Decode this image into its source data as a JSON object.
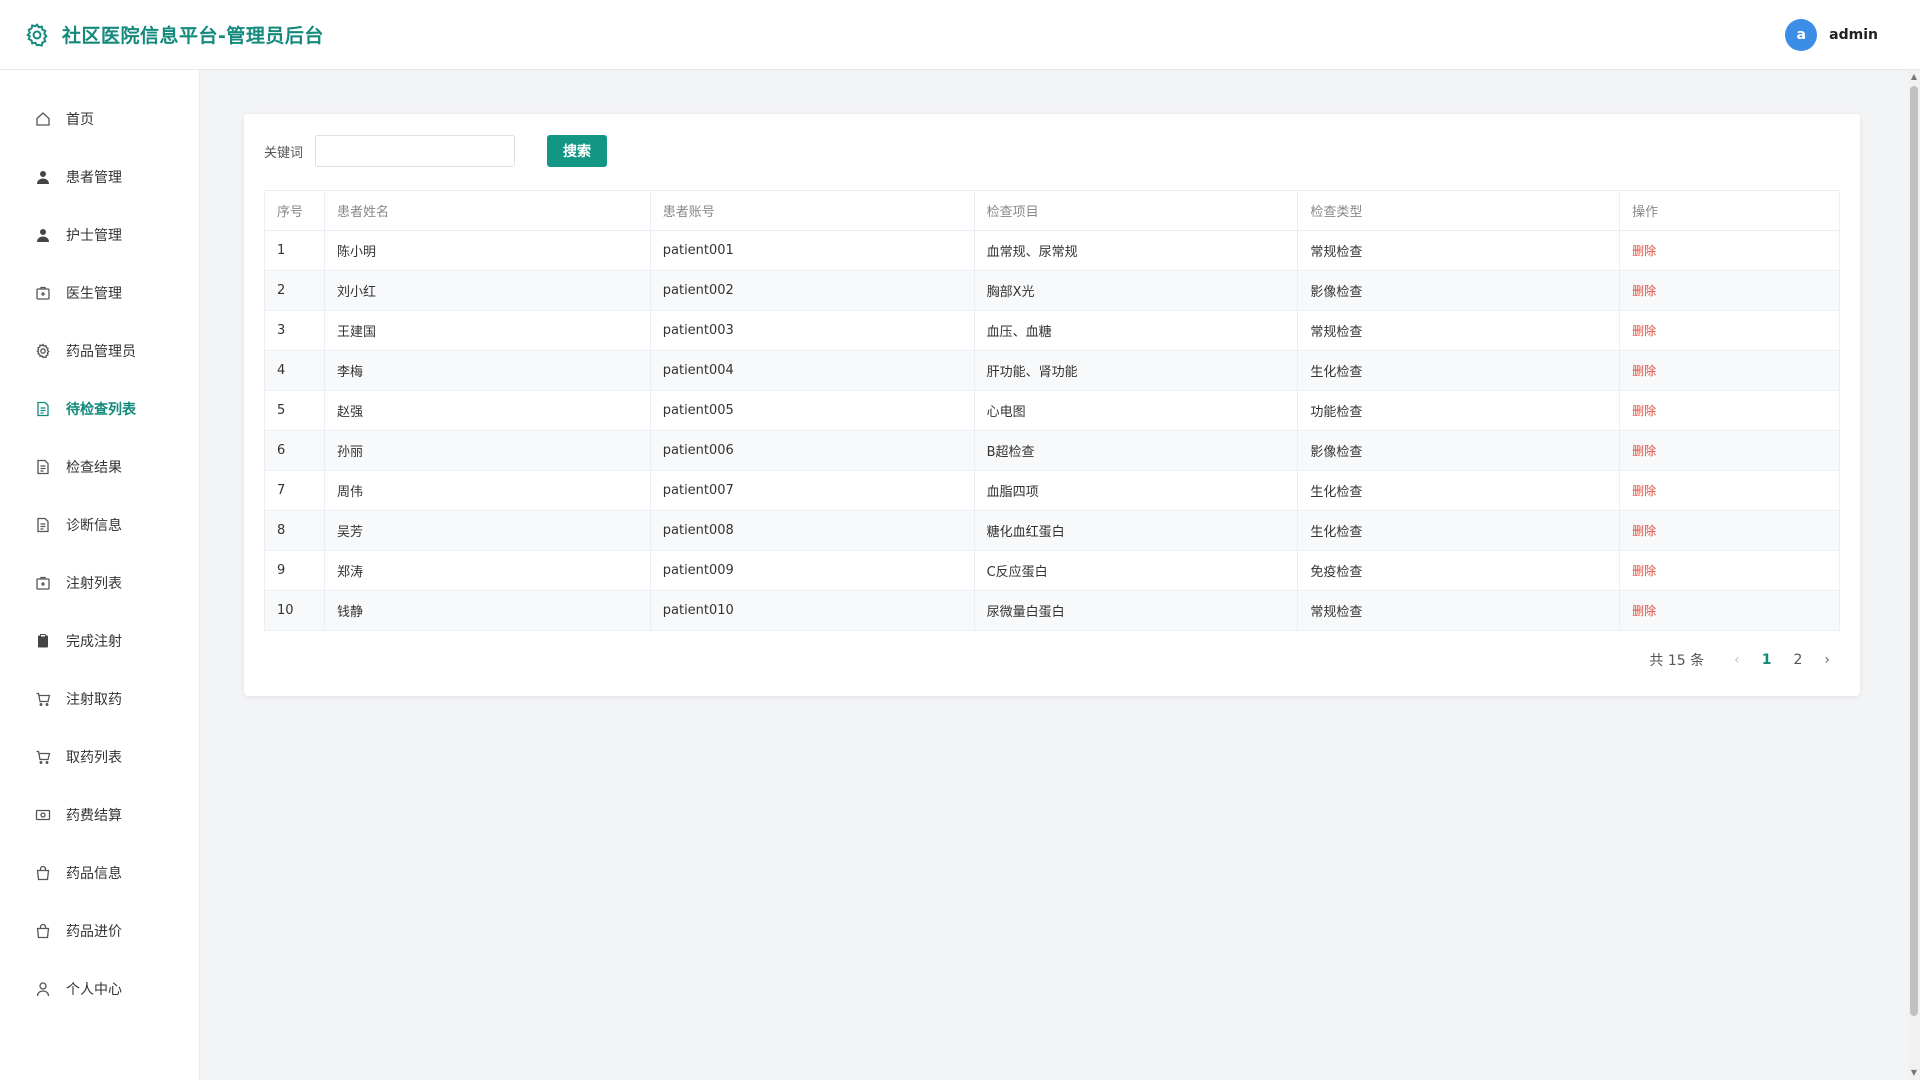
{
  "header": {
    "title": "社区医院信息平台-管理员后台",
    "avatar_letter": "a",
    "username": "admin"
  },
  "sidebar": {
    "items": [
      {
        "label": "首页",
        "icon": "home-icon"
      },
      {
        "label": "患者管理",
        "icon": "user-icon"
      },
      {
        "label": "护士管理",
        "icon": "user-icon"
      },
      {
        "label": "医生管理",
        "icon": "medkit-icon"
      },
      {
        "label": "药品管理员",
        "icon": "gear-icon"
      },
      {
        "label": "待检查列表",
        "icon": "document-icon",
        "active": true
      },
      {
        "label": "检查结果",
        "icon": "document-icon"
      },
      {
        "label": "诊断信息",
        "icon": "document-icon"
      },
      {
        "label": "注射列表",
        "icon": "medkit-icon"
      },
      {
        "label": "完成注射",
        "icon": "clipboard-icon"
      },
      {
        "label": "注射取药",
        "icon": "cart-icon"
      },
      {
        "label": "取药列表",
        "icon": "cart-icon"
      },
      {
        "label": "药费结算",
        "icon": "money-icon"
      },
      {
        "label": "药品信息",
        "icon": "bag-icon"
      },
      {
        "label": "药品进价",
        "icon": "bag-icon"
      },
      {
        "label": "个人中心",
        "icon": "user-outline-icon"
      }
    ]
  },
  "search": {
    "label": "关键词",
    "value": "",
    "placeholder": "",
    "button_label": "搜索"
  },
  "table": {
    "headers": [
      "序号",
      "患者姓名",
      "患者账号",
      "检查项目",
      "检查类型",
      "操作"
    ],
    "rows": [
      [
        "1",
        "陈小明",
        "patient001",
        "血常规、尿常规",
        "常规检查",
        "删除"
      ],
      [
        "2",
        "刘小红",
        "patient002",
        "胸部X光",
        "影像检查",
        "删除"
      ],
      [
        "3",
        "王建国",
        "patient003",
        "血压、血糖",
        "常规检查",
        "删除"
      ],
      [
        "4",
        "李梅",
        "patient004",
        "肝功能、肾功能",
        "生化检查",
        "删除"
      ],
      [
        "5",
        "赵强",
        "patient005",
        "心电图",
        "功能检查",
        "删除"
      ],
      [
        "6",
        "孙丽",
        "patient006",
        "B超检查",
        "影像检查",
        "删除"
      ],
      [
        "7",
        "周伟",
        "patient007",
        "血脂四项",
        "生化检查",
        "删除"
      ],
      [
        "8",
        "吴芳",
        "patient008",
        "糖化血红蛋白",
        "生化检查",
        "删除"
      ],
      [
        "9",
        "郑涛",
        "patient009",
        "C反应蛋白",
        "免疫检查",
        "删除"
      ],
      [
        "10",
        "钱静",
        "patient010",
        "尿微量白蛋白",
        "常规检查",
        "删除"
      ]
    ]
  },
  "pagination": {
    "total_text": "共 15 条",
    "prev": "‹",
    "next": "›",
    "pages": [
      "1",
      "2"
    ],
    "current": "1"
  },
  "colors": {
    "brand": "#138a7b",
    "button": "#149684",
    "danger": "#e74c3c",
    "avatar": "#3c8de6"
  }
}
